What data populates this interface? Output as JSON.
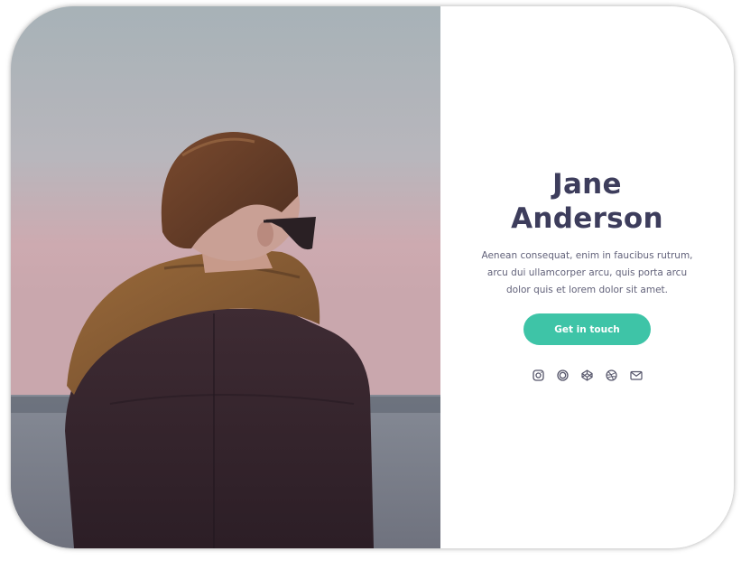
{
  "profile": {
    "name_first": "Jane",
    "name_last": "Anderson",
    "bio": "Aenean consequat, enim in faucibus rutrum, arcu dui ullamcorper arcu, quis porta arcu dolor quis et lorem dolor sit amet.",
    "cta_label": "Get in touch"
  },
  "socials": [
    {
      "icon": "instagram-icon"
    },
    {
      "icon": "circle-icon"
    },
    {
      "icon": "codepen-icon"
    },
    {
      "icon": "dribbble-icon"
    },
    {
      "icon": "mail-icon"
    }
  ],
  "colors": {
    "accent": "#3ec4a7",
    "name_text": "#3d3d5c",
    "body_text": "#62627a",
    "icon": "#55556a"
  }
}
